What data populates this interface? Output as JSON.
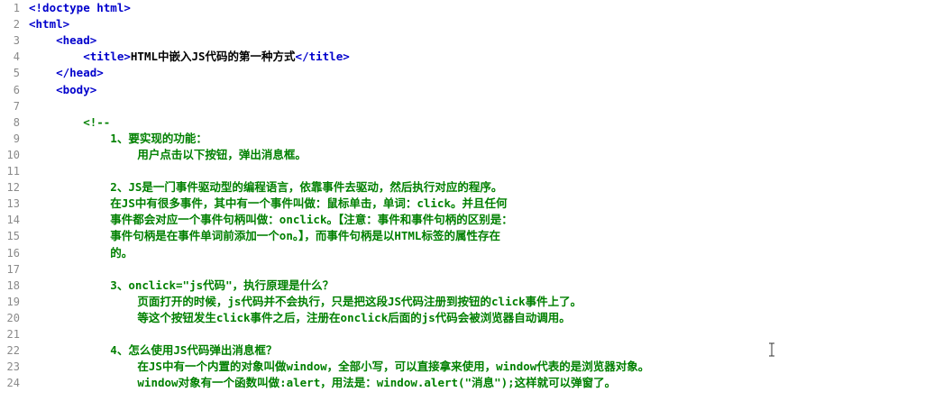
{
  "lines": [
    {
      "n": "1",
      "segments": [
        {
          "t": "tag",
          "v": "<!doctype html>"
        }
      ]
    },
    {
      "n": "2",
      "segments": [
        {
          "t": "tag",
          "v": "<html>"
        }
      ]
    },
    {
      "n": "3",
      "segments": [
        {
          "t": "tag",
          "v": "    <head>"
        }
      ]
    },
    {
      "n": "4",
      "segments": [
        {
          "t": "tag",
          "v": "        <title>"
        },
        {
          "t": "txt",
          "v": "HTML中嵌入JS代码的第一种方式"
        },
        {
          "t": "tag",
          "v": "</title>"
        }
      ]
    },
    {
      "n": "5",
      "segments": [
        {
          "t": "tag",
          "v": "    </head>"
        }
      ]
    },
    {
      "n": "6",
      "segments": [
        {
          "t": "tag",
          "v": "    <body>"
        }
      ]
    },
    {
      "n": "7",
      "segments": []
    },
    {
      "n": "8",
      "segments": [
        {
          "t": "cmt",
          "v": "        <!--"
        }
      ]
    },
    {
      "n": "9",
      "segments": [
        {
          "t": "cmt",
          "v": "            1、要实现的功能："
        }
      ]
    },
    {
      "n": "10",
      "segments": [
        {
          "t": "cmt",
          "v": "                用户点击以下按钮，弹出消息框。"
        }
      ]
    },
    {
      "n": "11",
      "segments": []
    },
    {
      "n": "12",
      "segments": [
        {
          "t": "cmt",
          "v": "            2、JS是一门事件驱动型的编程语言，依靠事件去驱动，然后执行对应的程序。"
        }
      ]
    },
    {
      "n": "13",
      "segments": [
        {
          "t": "cmt",
          "v": "            在JS中有很多事件，其中有一个事件叫做：鼠标单击，单词：click。并且任何"
        }
      ]
    },
    {
      "n": "14",
      "segments": [
        {
          "t": "cmt",
          "v": "            事件都会对应一个事件句柄叫做：onclick。【注意：事件和事件句柄的区别是："
        }
      ]
    },
    {
      "n": "15",
      "segments": [
        {
          "t": "cmt",
          "v": "            事件句柄是在事件单词前添加一个on。】，而事件句柄是以HTML标签的属性存在"
        }
      ]
    },
    {
      "n": "16",
      "segments": [
        {
          "t": "cmt",
          "v": "            的。"
        }
      ]
    },
    {
      "n": "17",
      "segments": []
    },
    {
      "n": "18",
      "segments": [
        {
          "t": "cmt",
          "v": "            3、onclick=\"js代码\"，执行原理是什么？"
        }
      ]
    },
    {
      "n": "19",
      "segments": [
        {
          "t": "cmt",
          "v": "                页面打开的时候，js代码并不会执行，只是把这段JS代码注册到按钮的click事件上了。"
        }
      ]
    },
    {
      "n": "20",
      "segments": [
        {
          "t": "cmt",
          "v": "                等这个按钮发生click事件之后，注册在onclick后面的js代码会被浏览器自动调用。"
        }
      ]
    },
    {
      "n": "21",
      "segments": []
    },
    {
      "n": "22",
      "segments": [
        {
          "t": "cmt",
          "v": "            4、怎么使用JS代码弹出消息框？"
        }
      ]
    },
    {
      "n": "23",
      "segments": [
        {
          "t": "cmt",
          "v": "                在JS中有一个内置的对象叫做window，全部小写，可以直接拿来使用，window代表的是浏览器对象。"
        }
      ]
    },
    {
      "n": "24",
      "segments": [
        {
          "t": "cmt",
          "v": "                window对象有一个函数叫做:alert，用法是：window.alert(\"消息\");这样就可以弹窗了。"
        }
      ]
    }
  ],
  "colors": {
    "tag": "#0000cc",
    "text": "#000000",
    "comment": "#008000",
    "line_number": "#8a8a8a"
  },
  "cursor_icon": "text-cursor-icon"
}
